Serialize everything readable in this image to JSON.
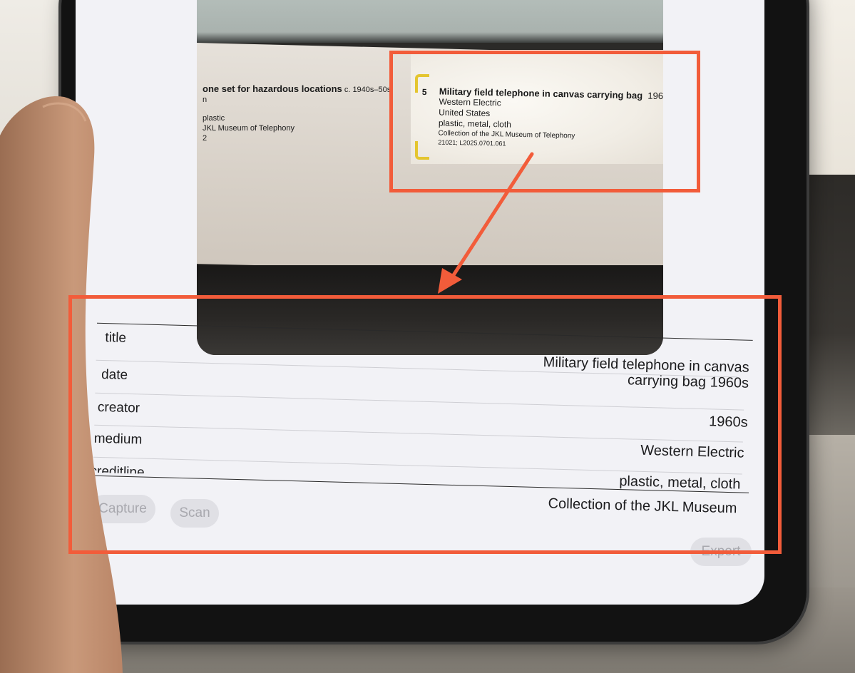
{
  "camera_label": {
    "left_partial": {
      "title_fragment": "one set for hazardous locations",
      "date_fragment": "c. 1940s–50s",
      "line2": "n",
      "line3": "plastic",
      "line4": "JKL Museum of Telephony",
      "line5": "2"
    },
    "main": {
      "number": "5",
      "title": "Military field telephone in canvas carrying bag",
      "title_date": "196",
      "maker": "Western Electric",
      "country": "United States",
      "materials": "plastic, metal, cloth",
      "credit": "Collection of the JKL Museum of Telephony",
      "accession": "21021; L2025.0701.061"
    }
  },
  "results": {
    "labels": [
      "title",
      "date",
      "creator",
      "medium",
      "creditline"
    ],
    "values": [
      "Military field telephone in canvas carrying bag 1960s",
      "1960s",
      "Western Electric",
      "plastic, metal, cloth",
      "Collection of the JKL Museum"
    ]
  },
  "toolbar": {
    "capture_label": "Capture",
    "scan_label": "Scan",
    "export_label": "Export"
  },
  "colors": {
    "annotation": "#f25c3a",
    "scan_bracket": "#e4c52f"
  }
}
